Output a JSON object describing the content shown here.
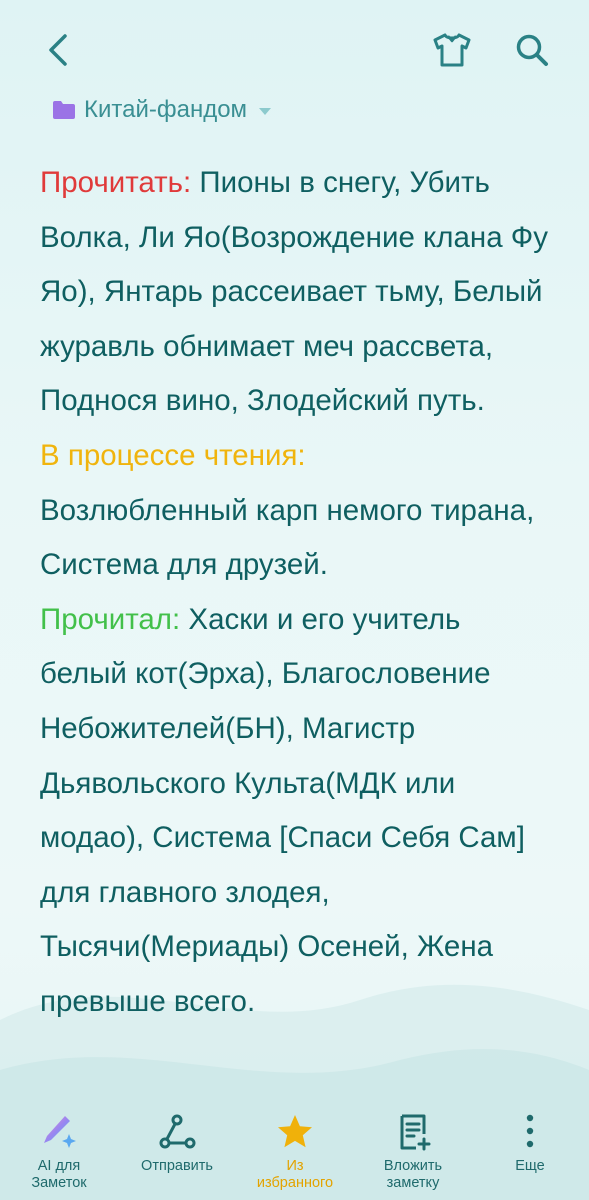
{
  "header": {
    "back_icon": "arrow-left-icon",
    "theme_icon": "tshirt-icon",
    "search_icon": "search-icon"
  },
  "folder": {
    "icon": "folder-icon",
    "color": "#9b73e6",
    "label": "Китай-фандом"
  },
  "note": {
    "want_label": "Прочитать:",
    "want_text": " Пионы в снегу, Убить Волка, Ли Яо(Возрождение клана Фу Яо), Янтарь рассеивает тьму, Белый журавль обнимает меч рассвета, Поднося вино, Злодейский путь.",
    "reading_label": "В процессе чтения:",
    "reading_text": "Возлюбленный карп немого тирана, Система для друзей.",
    "done_label": "Прочитал:",
    "done_text": " Хаски и его учитель белый кот(Эрха), Благословение Небожителей(БН), Магистр Дьявольского Культа(МДК или модао), Система [Спаси Себя Сам] для главного злодея, Тысячи(Мериады) Осеней, Жена превыше всего."
  },
  "colors": {
    "want": "#e03a3a",
    "reading": "#f0b40d",
    "done": "#42c04a",
    "text": "#0f5f61",
    "accent": "#e3a300"
  },
  "toolbar": {
    "ai": {
      "label_line1": "AI для",
      "label_line2": "Заметок",
      "icon": "ai-pen-sparkle-icon"
    },
    "share": {
      "label": "Отправить",
      "icon": "share-icon"
    },
    "favorite": {
      "label_line1": "Из",
      "label_line2": "избранного",
      "icon": "star-icon"
    },
    "attach": {
      "label_line1": "Вложить",
      "label_line2": "заметку",
      "icon": "attach-note-icon"
    },
    "more": {
      "label": "Еще",
      "icon": "more-vertical-icon"
    }
  }
}
